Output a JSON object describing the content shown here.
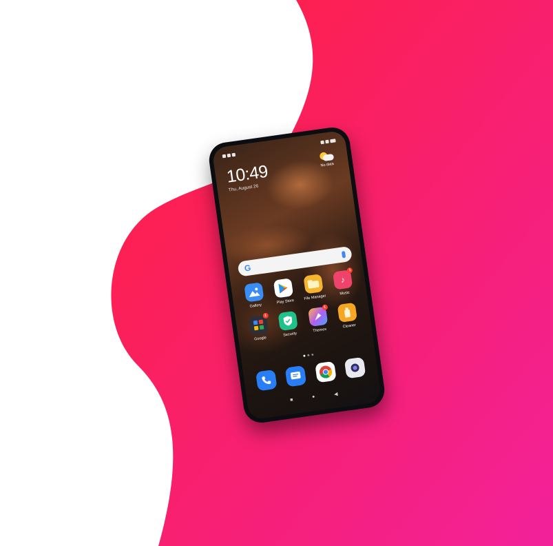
{
  "status_bar": {
    "left_icons": [
      "notification-icon",
      "notification-icon",
      "notification-icon"
    ],
    "right_icons": [
      "signal-icon",
      "wifi-icon",
      "battery-icon"
    ]
  },
  "lock": {
    "time": "10:49",
    "date": "Thu, August 26"
  },
  "weather": {
    "label": "No data",
    "icon": "partly-cloudy-icon"
  },
  "search": {
    "logo": "G",
    "icon": "mic-icon"
  },
  "apps": [
    {
      "label": "Gallery",
      "icon": "gallery-icon",
      "color": "#3a8df5"
    },
    {
      "label": "Play Store",
      "icon": "play-store-icon",
      "color": "#ffffff"
    },
    {
      "label": "File Manager",
      "icon": "folder-icon",
      "color": "#f5b52e"
    },
    {
      "label": "Music",
      "icon": "music-icon",
      "color": "#f0436b",
      "badge": "1"
    },
    {
      "label": "Google",
      "icon": "google-folder-icon",
      "color": "#2b2f3a",
      "badge": "1"
    },
    {
      "label": "Security",
      "icon": "security-icon",
      "color": "#1fc28a"
    },
    {
      "label": "Themes",
      "icon": "themes-icon",
      "color": "#b45cf0",
      "badge": "1"
    },
    {
      "label": "Cleaner",
      "icon": "cleaner-icon",
      "color": "#f5a623"
    }
  ],
  "dock": [
    {
      "icon": "phone-icon",
      "color": "#2a7ef5"
    },
    {
      "icon": "messages-icon",
      "color": "#2a7ef5"
    },
    {
      "icon": "chrome-icon",
      "color": "#ffffff"
    },
    {
      "icon": "camera-icon",
      "color": "#e9e9ef"
    }
  ],
  "colors": {
    "bg_gradient_start": "#ff1f3d",
    "bg_gradient_end": "#f2219a"
  }
}
